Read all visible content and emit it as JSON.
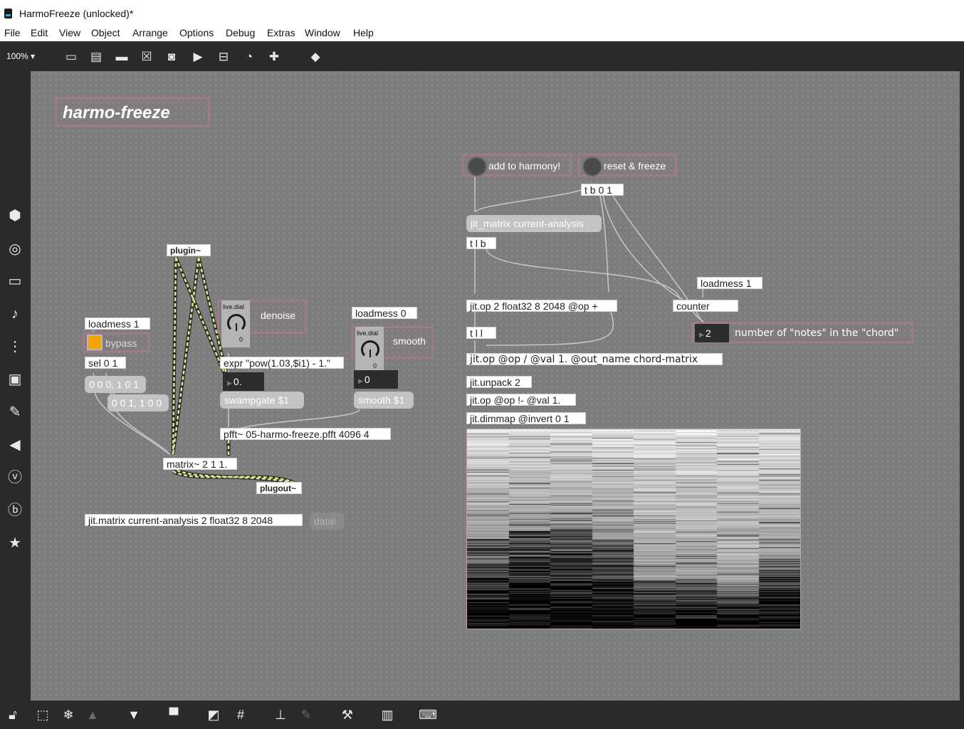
{
  "window": {
    "title": "HarmoFreeze (unlocked)*"
  },
  "menu": [
    "File",
    "Edit",
    "View",
    "Object",
    "Arrange",
    "Options",
    "Debug",
    "Extras",
    "Window",
    "Help"
  ],
  "toolbar": {
    "zoom": "100% ▾",
    "icons": [
      "presentation-icon",
      "message-icon",
      "comment-icon",
      "toggle-icon",
      "button-icon",
      "play-icon",
      "slider-icon",
      "dial-icon",
      "add-object-icon",
      "paint-bucket-icon"
    ]
  },
  "sidebar_icons": [
    "package-icon",
    "audio-icon",
    "video-icon",
    "music-icon",
    "sequence-icon",
    "image-icon",
    "attachment-icon",
    "plug-icon",
    "v-icon",
    "b-icon",
    "star-icon"
  ],
  "bottombar_icons": [
    "lock-icon",
    "select-icon",
    "freeze-icon",
    "warning-icon",
    "presentation-icon",
    "layers-icon",
    "align-icon",
    "grid-icon",
    "tree-icon",
    "connect-icon",
    "wrench-icon",
    "piano-icon",
    "keyboard-icon"
  ],
  "patch": {
    "title": "harmo-freeze",
    "plugin": "plugin~",
    "loadmess_left": "loadmess 1",
    "bypass": "bypass",
    "sel": "sel 0 1",
    "msg_a": "0 0 0, 1 0 1",
    "msg_b": "0 0 1, 1 0 0",
    "dial1_label": "live.dial",
    "dial1_value": "0",
    "denoise": "denoise",
    "expr": "expr \"pow(1.03,$i1) - 1.\"",
    "num1": "0.",
    "swampgate": "swampgate $1",
    "loadmess0": "loadmess 0",
    "dial2_label": "live.dial",
    "dial2_value": "0",
    "smooth": "smooth",
    "num2": "0",
    "smooth_msg": "smooth $1",
    "pfft": "pfft~ 05-harmo-freeze.pfft 4096 4",
    "matrix": "matrix~ 2 1 1.",
    "plugout": "plugout~",
    "jit_matrix_bottom": "jit.matrix current-analysis 2 float32 8 2048",
    "data": "data!",
    "add_harmony": "add to harmony!",
    "reset_freeze": "reset & freeze",
    "tb01": "t b 0 1",
    "jit_matrix_msg": "jit_matrix current-analysis",
    "tlb": "t l b",
    "loadmess1_right": "loadmess 1",
    "jitop1": "jit.op 2 float32 8 2048 @op +",
    "counter": "counter",
    "num3": "2",
    "notes_comment": "number of \"notes\" in the \"chord\"",
    "tll": "t l l",
    "jitop2": "jit.op @op / @val 1. @out_name chord-matrix",
    "unpack": "jit.unpack 2",
    "jitop3": "jit.op @op !- @val 1.",
    "dimmap": "jit.dimmap @invert 0 1"
  },
  "jit_display": {
    "columns": 8,
    "colors": {
      "light": "#ffffff",
      "dark": "#000000"
    }
  }
}
